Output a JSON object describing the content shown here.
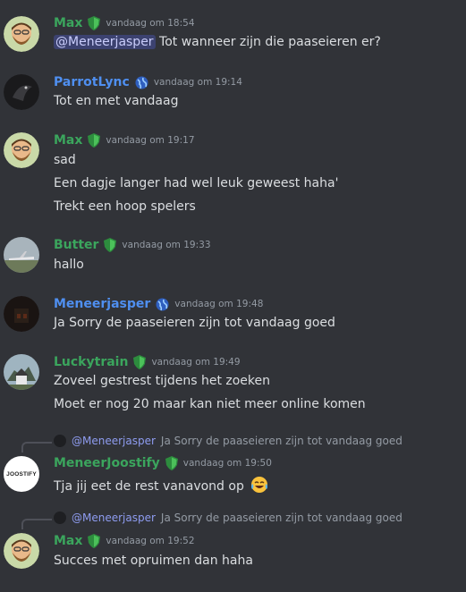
{
  "colors": {
    "green": "#3ba55d",
    "blue": "#4f8ff0",
    "background": "#313338"
  },
  "messages": [
    {
      "user": "Max",
      "badge": "green-shield-icon",
      "time": "vandaag om 18:54",
      "mention": "@Meneerjasper",
      "lines": [
        "Tot wanneer zijn die paaseieren er?"
      ]
    },
    {
      "user": "ParrotLync",
      "badge": "blue-globe-icon",
      "time": "vandaag om 19:14",
      "lines": [
        "Tot en met vandaag"
      ]
    },
    {
      "user": "Max",
      "badge": "green-shield-icon",
      "time": "vandaag om 19:17",
      "lines": [
        "sad",
        "Een dagje langer had wel leuk geweest haha'",
        "Trekt een hoop spelers"
      ]
    },
    {
      "user": "Butter",
      "badge": "green-shield-icon",
      "time": "vandaag om 19:33",
      "lines": [
        "hallo"
      ]
    },
    {
      "user": "Meneerjasper",
      "badge": "blue-globe-icon",
      "time": "vandaag om 19:48",
      "lines": [
        "Ja Sorry de paaseieren zijn tot vandaag goed"
      ]
    },
    {
      "user": "Luckytrain",
      "badge": "green-shield-icon",
      "time": "vandaag om 19:49",
      "lines": [
        "Zoveel gestrest tijdens het zoeken",
        "Moet er nog 20 maar kan niet meer online komen"
      ]
    },
    {
      "reply_mention": "@Meneerjasper",
      "reply_text": "Ja Sorry de paaseieren zijn tot vandaag goed",
      "user": "MeneerJoostify",
      "badge": "green-shield-icon",
      "time": "vandaag om 19:50",
      "lines": [
        "Tja jij eet de rest vanavond op"
      ],
      "avatar_text": "JOOSTIFY",
      "emoji": "laughing-tears-emoji"
    },
    {
      "reply_mention": "@Meneerjasper",
      "reply_text": "Ja Sorry de paaseieren zijn tot vandaag goed",
      "user": "Max",
      "badge": "green-shield-icon",
      "time": "vandaag om 19:52",
      "lines": [
        "Succes met opruimen dan haha"
      ]
    }
  ]
}
